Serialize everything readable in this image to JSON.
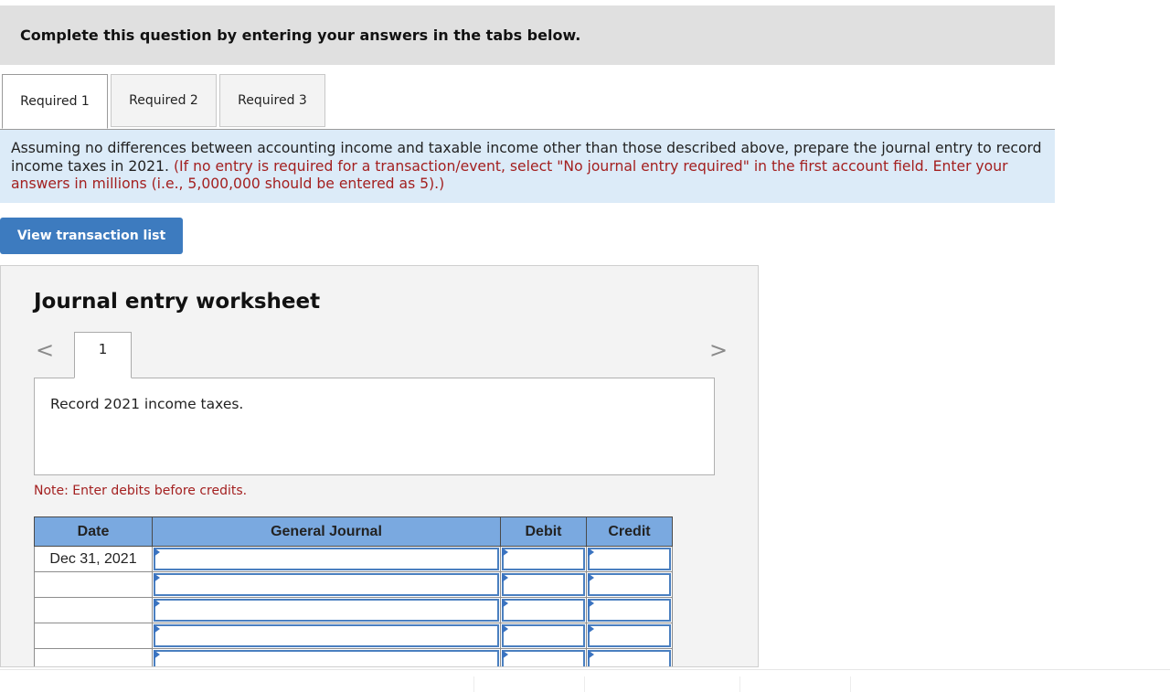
{
  "banner": {
    "text": "Complete this question by entering your answers in the tabs below."
  },
  "tabs": [
    {
      "label": "Required 1",
      "active": true
    },
    {
      "label": "Required 2",
      "active": false
    },
    {
      "label": "Required 3",
      "active": false
    }
  ],
  "instructions": {
    "main": "Assuming no differences between accounting income and taxable income other than those described above, prepare the journal entry to record income taxes in 2021.",
    "note": "(If no entry is required for a transaction/event, select \"No journal entry required\" in the first account field. Enter your answers in millions (i.e., 5,000,000 should be entered as 5).)"
  },
  "view_button": {
    "label": "View transaction list"
  },
  "worksheet": {
    "title": "Journal entry worksheet",
    "prev_arrow": "<",
    "next_arrow": ">",
    "entry_tab": "1",
    "description": "Record 2021 income taxes.",
    "note": "Note: Enter debits before credits.",
    "columns": {
      "date": "Date",
      "journal": "General Journal",
      "debit": "Debit",
      "credit": "Credit"
    },
    "rows": [
      {
        "date": "Dec 31, 2021",
        "account": "",
        "debit": "",
        "credit": ""
      },
      {
        "date": "",
        "account": "",
        "debit": "",
        "credit": ""
      },
      {
        "date": "",
        "account": "",
        "debit": "",
        "credit": ""
      },
      {
        "date": "",
        "account": "",
        "debit": "",
        "credit": ""
      },
      {
        "date": "",
        "account": "",
        "debit": "",
        "credit": ""
      }
    ]
  },
  "colors": {
    "header_blue": "#7aa9e0",
    "button_blue": "#3d7bbf",
    "instruction_bg": "#dcebf8",
    "note_red": "#a31f1f"
  }
}
